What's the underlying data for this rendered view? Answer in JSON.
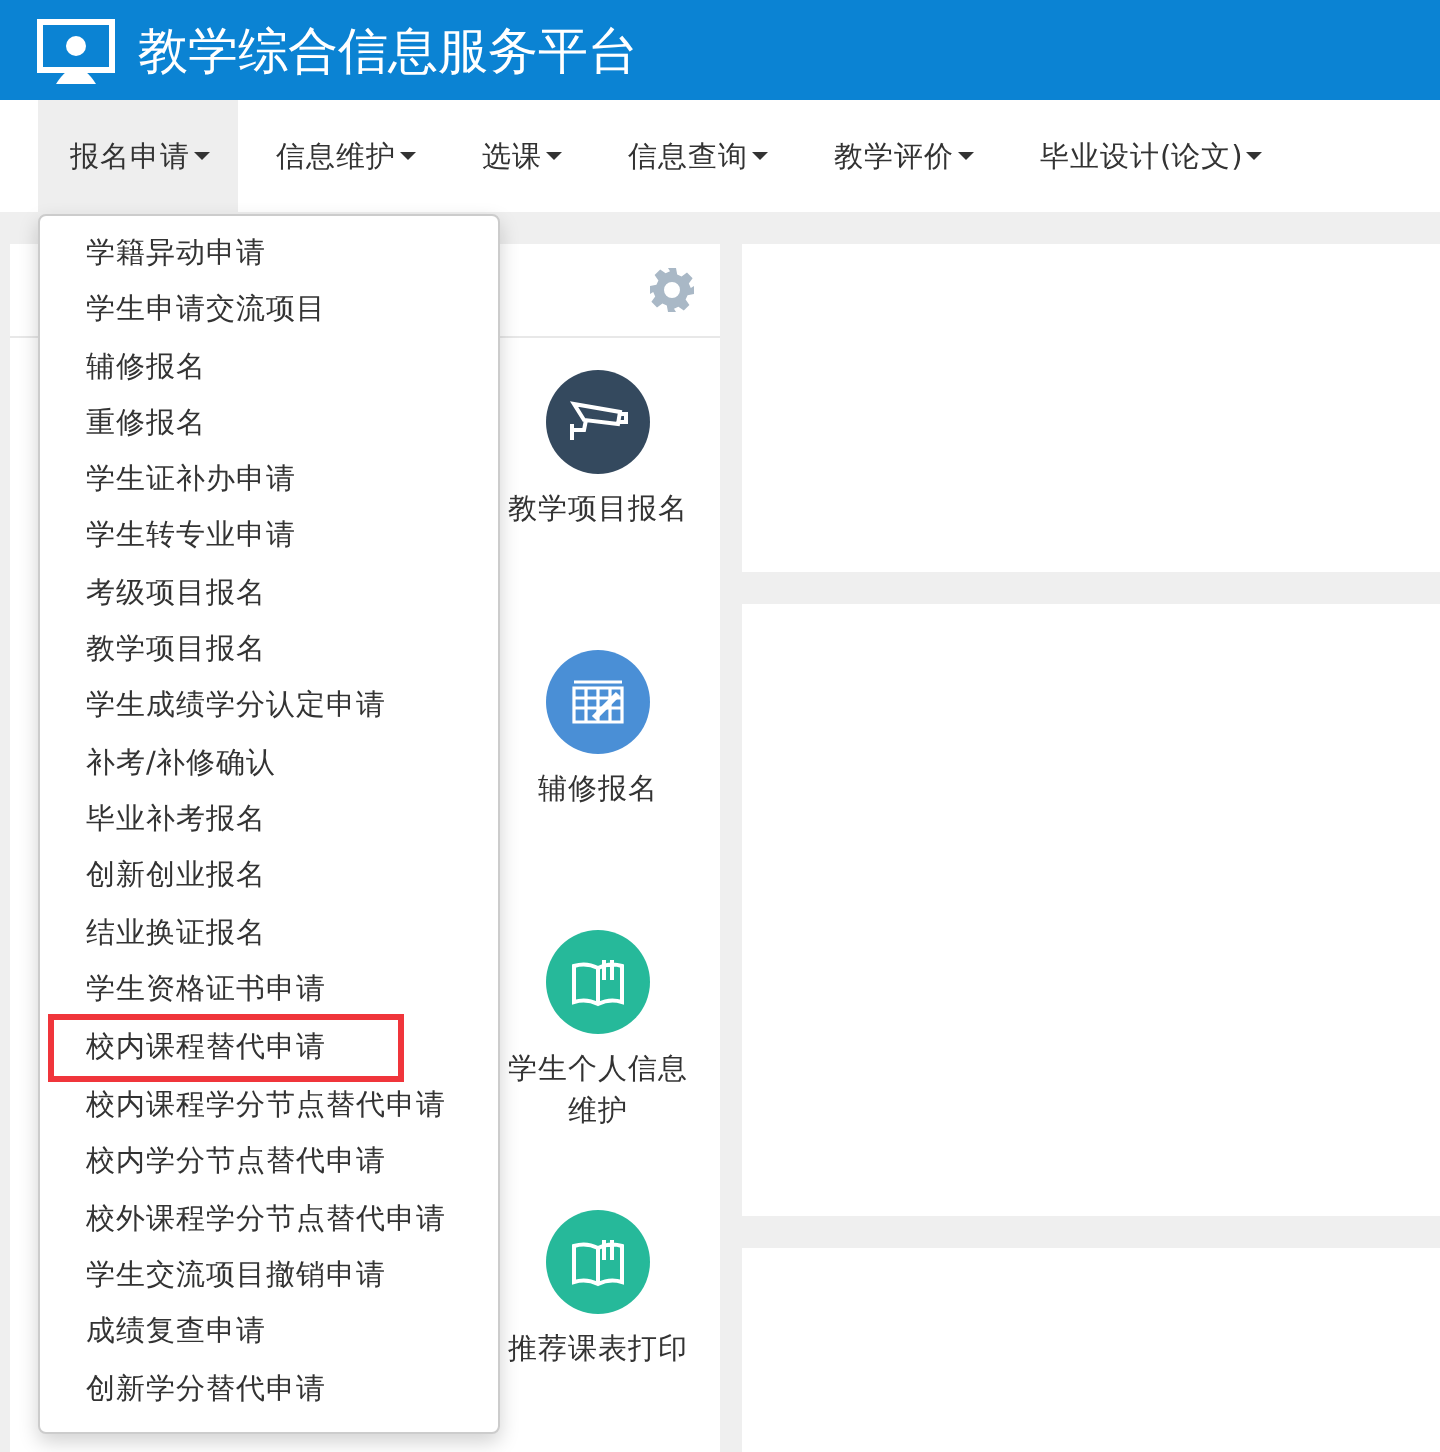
{
  "header": {
    "title": "教学综合信息服务平台"
  },
  "nav": [
    {
      "label": "报名申请",
      "selected": true
    },
    {
      "label": "信息维护",
      "selected": false
    },
    {
      "label": "选课",
      "selected": false
    },
    {
      "label": "信息查询",
      "selected": false
    },
    {
      "label": "教学评价",
      "selected": false
    },
    {
      "label": "毕业设计(论文)",
      "selected": false
    }
  ],
  "dropdown": [
    {
      "label": "学籍异动申请",
      "highlighted": false
    },
    {
      "label": "学生申请交流项目",
      "highlighted": false
    },
    {
      "label": "辅修报名",
      "highlighted": false
    },
    {
      "label": "重修报名",
      "highlighted": false
    },
    {
      "label": "学生证补办申请",
      "highlighted": false
    },
    {
      "label": "学生转专业申请",
      "highlighted": false
    },
    {
      "label": "考级项目报名",
      "highlighted": false
    },
    {
      "label": "教学项目报名",
      "highlighted": false
    },
    {
      "label": "学生成绩学分认定申请",
      "highlighted": false
    },
    {
      "label": "补考/补修确认",
      "highlighted": false
    },
    {
      "label": "毕业补考报名",
      "highlighted": false
    },
    {
      "label": "创新创业报名",
      "highlighted": false
    },
    {
      "label": "结业换证报名",
      "highlighted": false
    },
    {
      "label": "学生资格证书申请",
      "highlighted": false
    },
    {
      "label": "校内课程替代申请",
      "highlighted": true
    },
    {
      "label": "校内课程学分节点替代申请",
      "highlighted": false
    },
    {
      "label": "校内学分节点替代申请",
      "highlighted": false
    },
    {
      "label": "校外课程学分节点替代申请",
      "highlighted": false
    },
    {
      "label": "学生交流项目撤销申请",
      "highlighted": false
    },
    {
      "label": "成绩复查申请",
      "highlighted": false
    },
    {
      "label": "创新学分替代申请",
      "highlighted": false
    }
  ],
  "shortcuts": [
    {
      "label": "教学项目报名",
      "kind": "camera",
      "color": "#34495e"
    },
    {
      "label": "辅修报名",
      "kind": "grid",
      "color": "#4a8fd6"
    },
    {
      "label": "学生个人信息维护",
      "kind": "book",
      "color": "#26b99a"
    },
    {
      "label": "推荐课表打印",
      "kind": "book",
      "color": "#26b99a"
    }
  ]
}
